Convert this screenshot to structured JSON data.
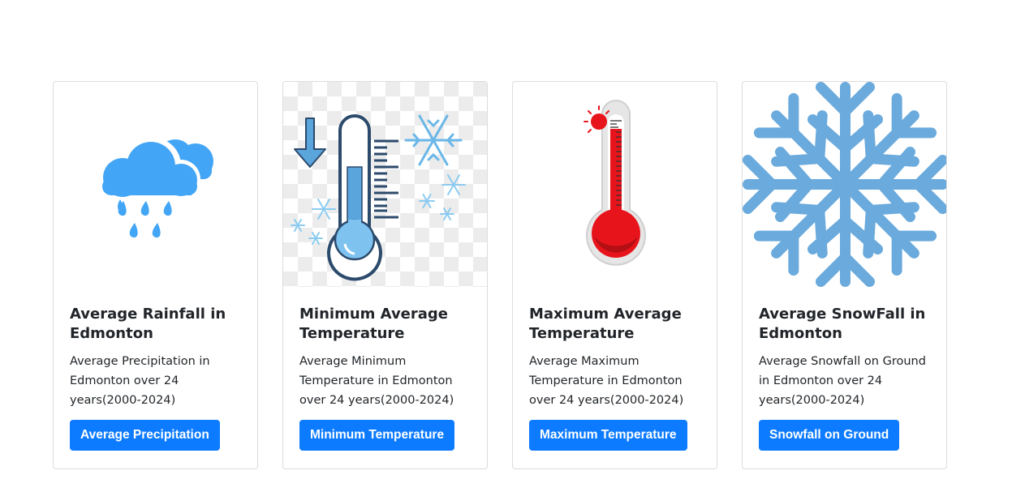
{
  "cards": [
    {
      "title": "Average Rainfall in Edmonton",
      "text": "Average Precipitation in Edmonton over 24 years(2000-2024)",
      "button": "Average Precipitation",
      "icon": "rain-cloud-icon"
    },
    {
      "title": "Minimum Average Temperature",
      "text": "Average Minimum Temperature in Edmonton over 24 years(2000-2024)",
      "button": "Minimum Temperature",
      "icon": "cold-thermometer-icon"
    },
    {
      "title": "Maximum Average Temperature",
      "text": "Average Maximum Temperature in Edmonton over 24 years(2000-2024)",
      "button": "Maximum Temperature",
      "icon": "hot-thermometer-icon"
    },
    {
      "title": "Average SnowFall in Edmonton",
      "text": "Average Snowfall on Ground in Edmonton over 24 years(2000-2024)",
      "button": "Snowfall on Ground",
      "icon": "snowflake-icon"
    }
  ],
  "colors": {
    "button": "#0d7bff",
    "rain_cloud": "#42a5f5",
    "thermo_red": "#e8141b",
    "snowflake": "#6aaadc"
  }
}
